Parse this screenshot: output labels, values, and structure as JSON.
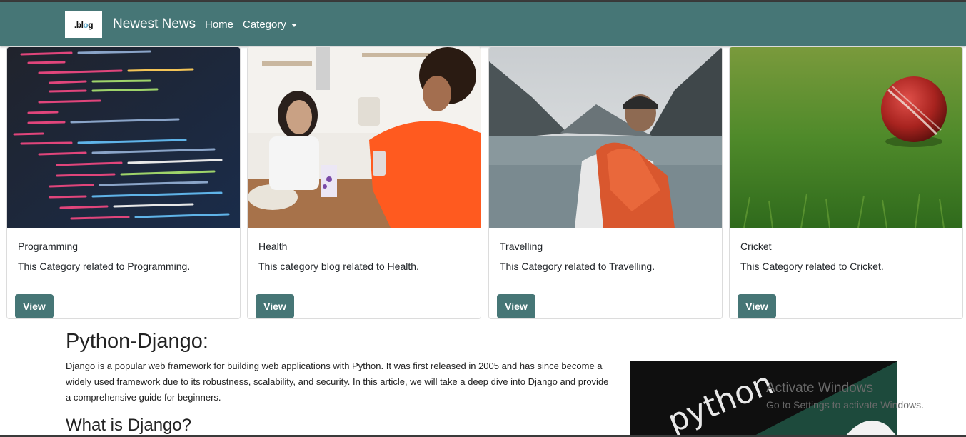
{
  "navbar": {
    "logo_text_a": ".bl",
    "logo_text_o": "o",
    "logo_text_b": "g",
    "brand": "Newest News",
    "home": "Home",
    "category": "Category"
  },
  "cards": [
    {
      "title": "Programming",
      "text": "This Category related to Programming.",
      "button": "View",
      "image": "code-editor-photo"
    },
    {
      "title": "Health",
      "text": "This category blog related to Health.",
      "button": "View",
      "image": "friends-kitchen-photo"
    },
    {
      "title": "Travelling",
      "text": "This Category related to Travelling.",
      "button": "View",
      "image": "lake-backpacker-photo"
    },
    {
      "title": "Cricket",
      "text": "This Category related to Cricket.",
      "button": "View",
      "image": "cricket-ball-photo"
    }
  ],
  "article": {
    "heading": "Python-Django:",
    "paragraph": "Django is a popular web framework for building web applications with Python. It was first released in 2005 and has since become a widely used framework due to its robustness, scalability, and security. In this article, we will take a deep dive into Django and provide a comprehensive guide for beginners.",
    "subheading": "What is Django?",
    "image_text": "python"
  },
  "watermark": {
    "line1": "Activate Windows",
    "line2": "Go to Settings to activate Windows."
  },
  "colors": {
    "navbar": "#467676",
    "button": "#467676"
  }
}
